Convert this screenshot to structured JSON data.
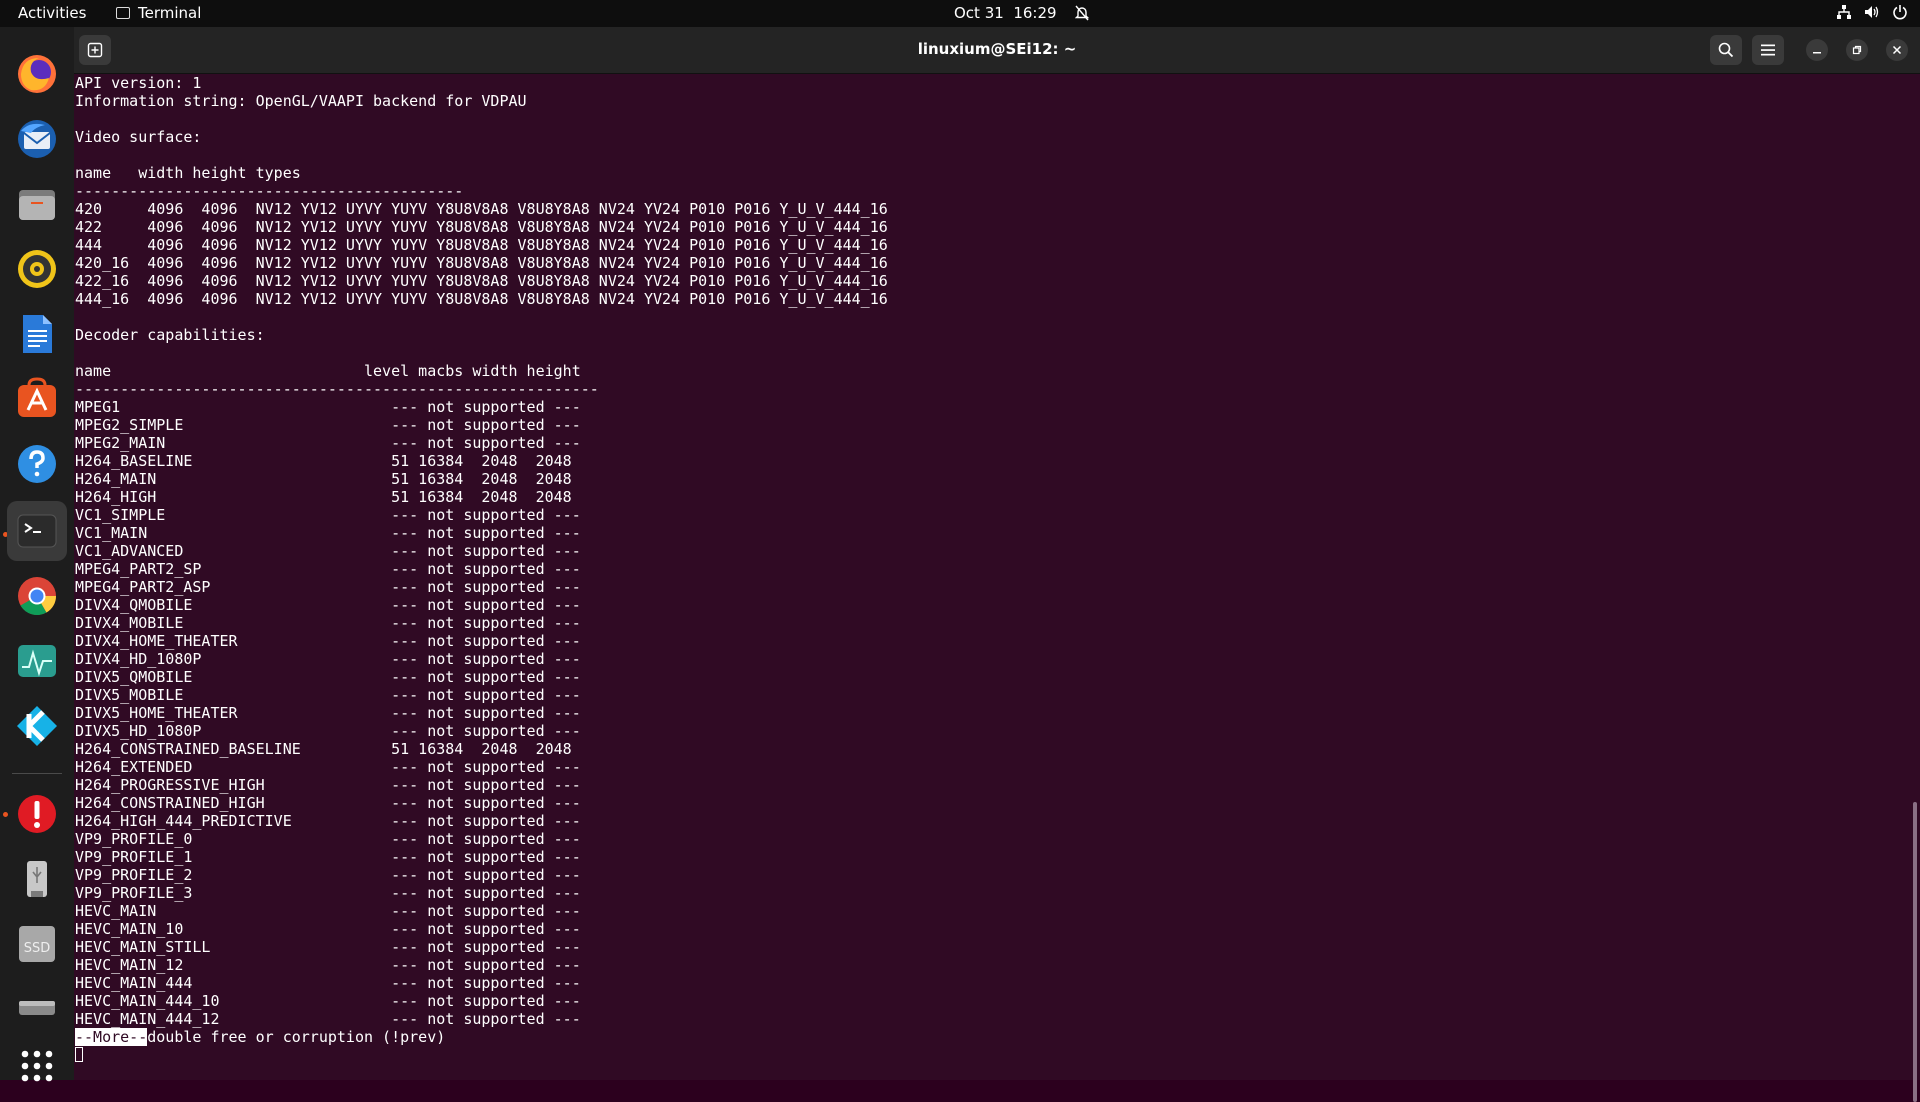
{
  "topbar": {
    "activities": "Activities",
    "app_name": "Terminal",
    "date": "Oct 31",
    "time": "16:29"
  },
  "window": {
    "title": "linuxium@SEi12: ~"
  },
  "dock": {
    "items": [
      {
        "name": "firefox-icon"
      },
      {
        "name": "thunderbird-icon"
      },
      {
        "name": "files-icon"
      },
      {
        "name": "rhythmbox-icon"
      },
      {
        "name": "libreoffice-writer-icon"
      },
      {
        "name": "app-center-icon"
      },
      {
        "name": "help-icon"
      },
      {
        "name": "terminal-icon"
      },
      {
        "name": "chrome-icon"
      },
      {
        "name": "system-monitor-icon"
      },
      {
        "name": "kodi-icon"
      },
      {
        "name": "error-report-icon"
      },
      {
        "name": "usb-drive-icon"
      },
      {
        "name": "ssd-drive-icon"
      },
      {
        "name": "drive-icon"
      },
      {
        "name": "show-apps-icon"
      }
    ],
    "ssd_label": "SSD"
  },
  "colors": {
    "terminal_bg": "#300a24",
    "accent": "#e95420"
  },
  "terminal": {
    "lines": [
      "API version: 1",
      "Information string: OpenGL/VAAPI backend for VDPAU",
      "",
      "Video surface:",
      "",
      "name   width height types",
      "-------------------------------------------",
      "420     4096  4096  NV12 YV12 UYVY YUYV Y8U8V8A8 V8U8Y8A8 NV24 YV24 P010 P016 Y_U_V_444_16",
      "422     4096  4096  NV12 YV12 UYVY YUYV Y8U8V8A8 V8U8Y8A8 NV24 YV24 P010 P016 Y_U_V_444_16",
      "444     4096  4096  NV12 YV12 UYVY YUYV Y8U8V8A8 V8U8Y8A8 NV24 YV24 P010 P016 Y_U_V_444_16",
      "420_16  4096  4096  NV12 YV12 UYVY YUYV Y8U8V8A8 V8U8Y8A8 NV24 YV24 P010 P016 Y_U_V_444_16",
      "422_16  4096  4096  NV12 YV12 UYVY YUYV Y8U8V8A8 V8U8Y8A8 NV24 YV24 P010 P016 Y_U_V_444_16",
      "444_16  4096  4096  NV12 YV12 UYVY YUYV Y8U8V8A8 V8U8Y8A8 NV24 YV24 P010 P016 Y_U_V_444_16",
      "",
      "Decoder capabilities:",
      "",
      "name                            level macbs width height",
      "----------------------------------------------------------",
      "MPEG1                              --- not supported ---",
      "MPEG2_SIMPLE                       --- not supported ---",
      "MPEG2_MAIN                         --- not supported ---",
      "H264_BASELINE                      51 16384  2048  2048",
      "H264_MAIN                          51 16384  2048  2048",
      "H264_HIGH                          51 16384  2048  2048",
      "VC1_SIMPLE                         --- not supported ---",
      "VC1_MAIN                           --- not supported ---",
      "VC1_ADVANCED                       --- not supported ---",
      "MPEG4_PART2_SP                     --- not supported ---",
      "MPEG4_PART2_ASP                    --- not supported ---",
      "DIVX4_QMOBILE                      --- not supported ---",
      "DIVX4_MOBILE                       --- not supported ---",
      "DIVX4_HOME_THEATER                 --- not supported ---",
      "DIVX4_HD_1080P                     --- not supported ---",
      "DIVX5_QMOBILE                      --- not supported ---",
      "DIVX5_MOBILE                       --- not supported ---",
      "DIVX5_HOME_THEATER                 --- not supported ---",
      "DIVX5_HD_1080P                     --- not supported ---",
      "H264_CONSTRAINED_BASELINE          51 16384  2048  2048",
      "H264_EXTENDED                      --- not supported ---",
      "H264_PROGRESSIVE_HIGH              --- not supported ---",
      "H264_CONSTRAINED_HIGH              --- not supported ---",
      "H264_HIGH_444_PREDICTIVE           --- not supported ---",
      "VP9_PROFILE_0                      --- not supported ---",
      "VP9_PROFILE_1                      --- not supported ---",
      "VP9_PROFILE_2                      --- not supported ---",
      "VP9_PROFILE_3                      --- not supported ---",
      "HEVC_MAIN                          --- not supported ---",
      "HEVC_MAIN_10                       --- not supported ---",
      "HEVC_MAIN_STILL                    --- not supported ---",
      "HEVC_MAIN_12                       --- not supported ---",
      "HEVC_MAIN_444                      --- not supported ---",
      "HEVC_MAIN_444_10                   --- not supported ---",
      "HEVC_MAIN_444_12                   --- not supported ---"
    ],
    "more_prompt": "--More--",
    "more_tail": "double free or corruption (!prev)"
  }
}
